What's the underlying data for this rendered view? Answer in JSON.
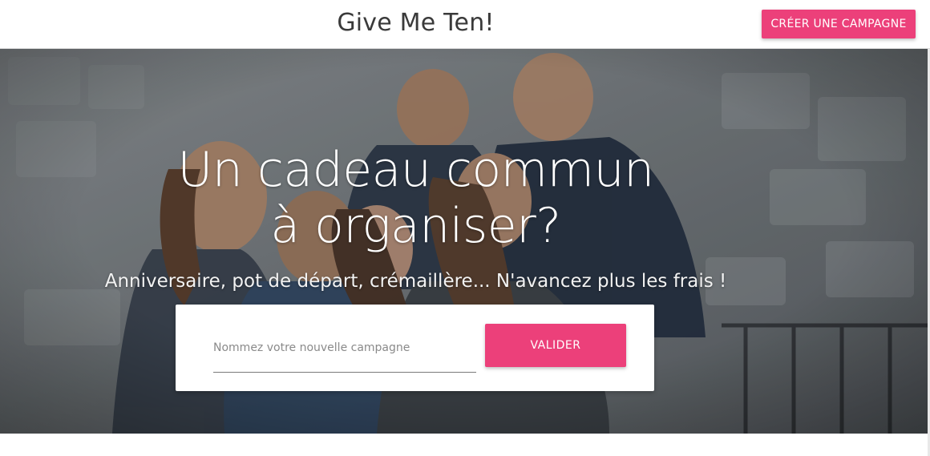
{
  "header": {
    "brand": "Give Me Ten!",
    "cta_label": "CRÉER UNE CAMPAGNE"
  },
  "hero": {
    "title": "Un cadeau commun à organiser?",
    "subtitle": "Anniversaire, pot de départ, crémaillère... N'avancez plus les frais !",
    "background_image": "group-of-friends-hugging-photo"
  },
  "form": {
    "input_placeholder": "Nommez votre nouvelle campagne",
    "input_value": "",
    "submit_label": "VALIDER"
  },
  "colors": {
    "accent": "#ec407a",
    "header_bg": "#ffffff",
    "brand_text": "#3a3a3a"
  }
}
